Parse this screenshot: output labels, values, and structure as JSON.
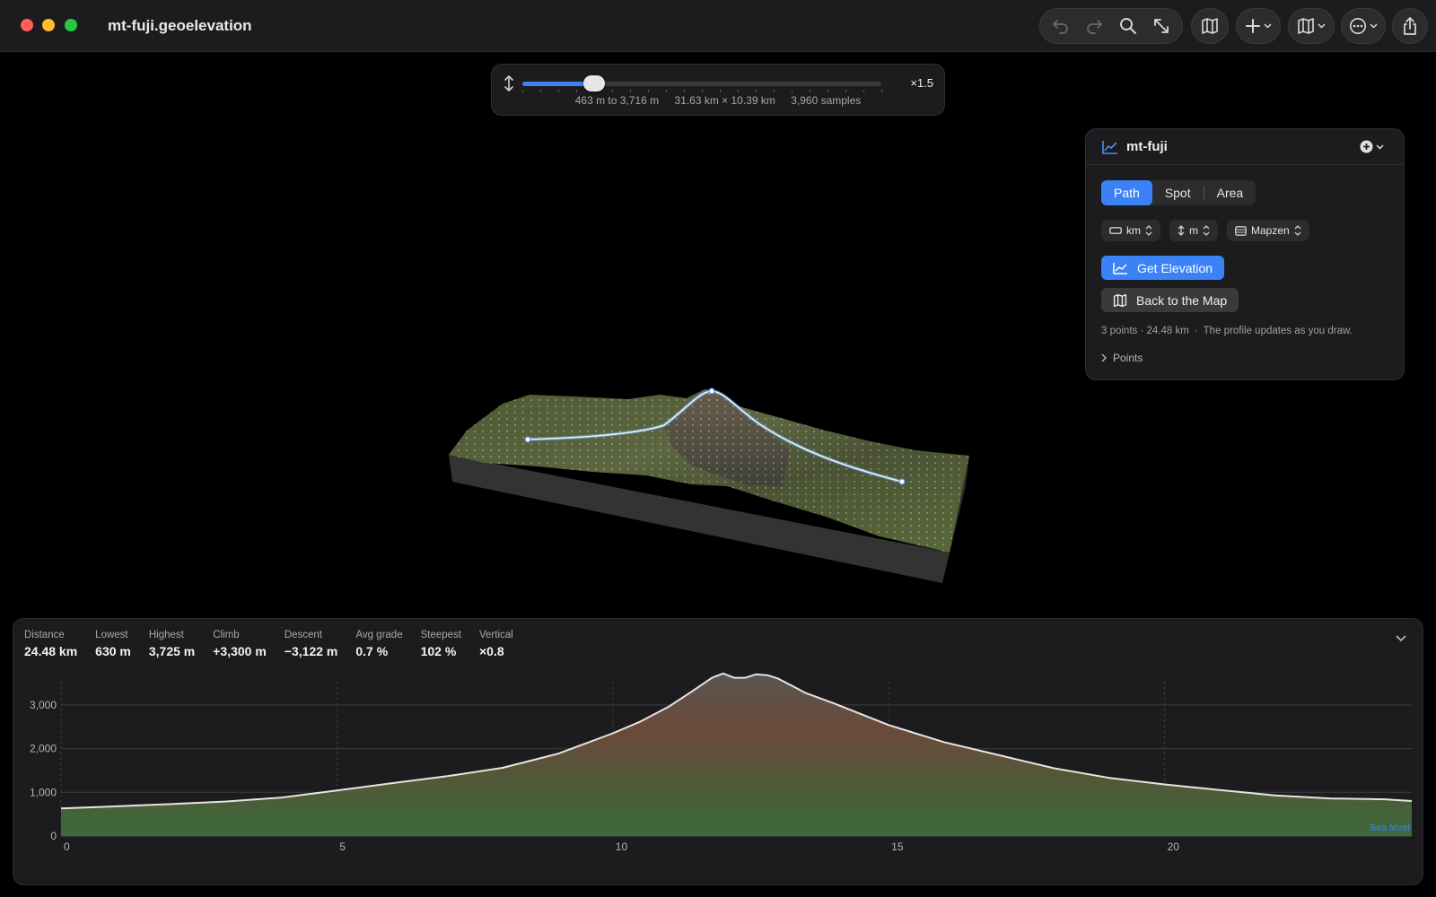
{
  "window": {
    "title": "mt-fuji.geoelevation"
  },
  "toolbar": {
    "icons": [
      "undo-icon",
      "redo-icon",
      "search-icon",
      "expand-icon",
      "map-icon",
      "add-icon",
      "map-style-icon",
      "more-icon",
      "share-icon"
    ]
  },
  "exaggeration": {
    "value_label": "×1.5",
    "range": "463 m to 3,716 m",
    "dimensions": "31.63 km × 10.39 km",
    "samples": "3,960 samples",
    "slider_fraction": 0.2
  },
  "panel": {
    "title": "mt-fuji",
    "modes": [
      "Path",
      "Spot",
      "Area"
    ],
    "active_mode": "Path",
    "distance_unit": "km",
    "elevation_unit": "m",
    "source": "Mapzen",
    "get_elevation_label": "Get Elevation",
    "back_to_map_label": "Back to the Map",
    "summary": "3 points · 24.48 km",
    "note": "The profile updates as you draw.",
    "points_label": "Points"
  },
  "stats": [
    {
      "label": "Distance",
      "value": "24.48 km"
    },
    {
      "label": "Lowest",
      "value": "630 m"
    },
    {
      "label": "Highest",
      "value": "3,725 m"
    },
    {
      "label": "Climb",
      "value": "+3,300 m"
    },
    {
      "label": "Descent",
      "value": "−3,122 m"
    },
    {
      "label": "Avg grade",
      "value": "0.7 %"
    },
    {
      "label": "Steepest",
      "value": "102 %"
    },
    {
      "label": "Vertical",
      "value": "×0.8"
    }
  ],
  "chart_data": {
    "type": "area",
    "x_ticks": [
      "0",
      "5",
      "10",
      "15",
      "20"
    ],
    "y_ticks": [
      "0",
      "1,000",
      "2,000",
      "3,000"
    ],
    "xlim": [
      0,
      24.48
    ],
    "ylim": [
      0,
      3900
    ],
    "sea_level_label": "Sea level",
    "x": [
      0,
      1,
      2,
      3,
      4,
      5,
      6,
      7,
      8,
      9,
      10,
      10.5,
      11,
      11.4,
      11.8,
      12.0,
      12.2,
      12.4,
      12.6,
      12.8,
      13,
      13.5,
      14,
      15,
      16,
      17,
      18,
      19,
      20,
      21,
      22,
      23,
      24,
      24.48
    ],
    "y": [
      630,
      680,
      730,
      790,
      880,
      1040,
      1210,
      1370,
      1560,
      1880,
      2350,
      2620,
      2950,
      3280,
      3620,
      3720,
      3620,
      3620,
      3700,
      3680,
      3600,
      3270,
      3040,
      2540,
      2150,
      1850,
      1550,
      1330,
      1180,
      1050,
      930,
      860,
      840,
      800
    ]
  }
}
